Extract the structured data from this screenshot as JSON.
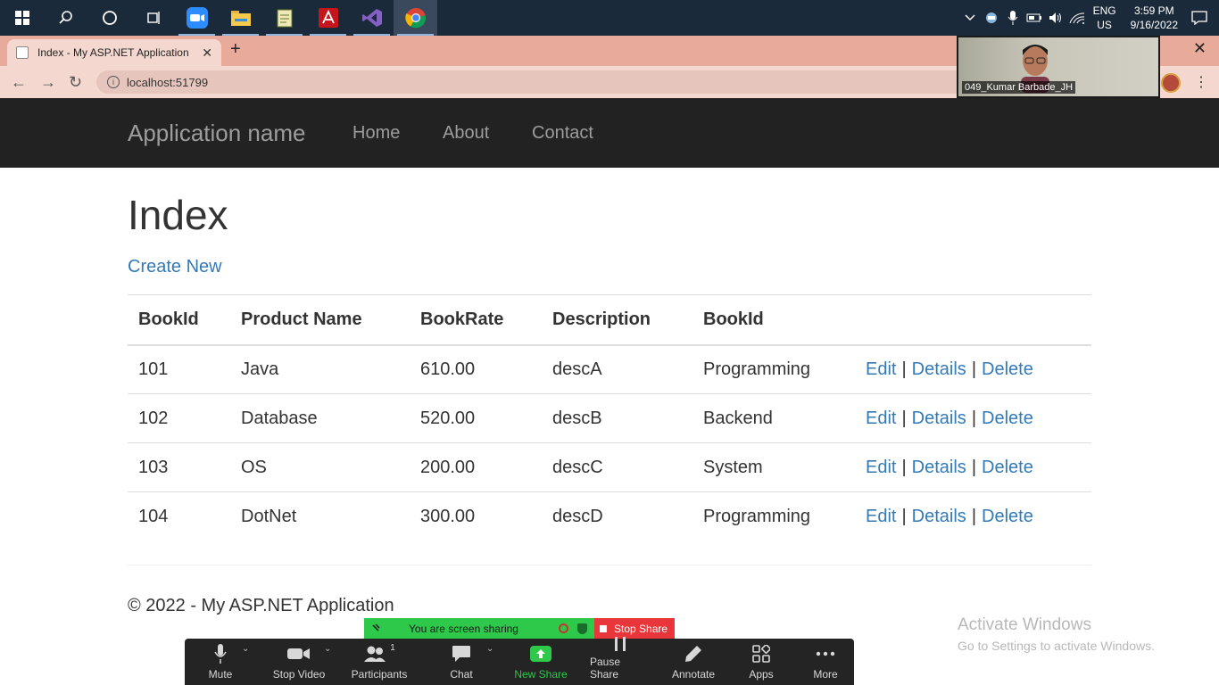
{
  "taskbar": {
    "apps": [
      "start-icon",
      "search-icon",
      "cortana-icon",
      "task-view-icon",
      "zoom-icon",
      "file-explorer-icon",
      "notepad-icon",
      "acrobat-icon",
      "visual-studio-icon",
      "chrome-icon"
    ],
    "lang_line1": "ENG",
    "lang_line2": "US",
    "time": "3:59 PM",
    "date": "9/16/2022"
  },
  "browser": {
    "tab_title": "Index - My ASP.NET Application",
    "url": "localhost:51799"
  },
  "video": {
    "participant_name": "049_Kumar Barbade_JH"
  },
  "navbar": {
    "brand": "Application name",
    "links": [
      "Home",
      "About",
      "Contact"
    ]
  },
  "page": {
    "title": "Index",
    "create_link": "Create New",
    "footer": "© 2022 - My ASP.NET Application"
  },
  "table": {
    "headers": [
      "BookId",
      "Product Name",
      "BookRate",
      "Description",
      "BookId"
    ],
    "rows": [
      [
        "101",
        "Java",
        "610.00",
        "descA",
        "Programming"
      ],
      [
        "102",
        "Database",
        "520.00",
        "descB",
        "Backend"
      ],
      [
        "103",
        "OS",
        "200.00",
        "descC",
        "System"
      ],
      [
        "104",
        "DotNet",
        "300.00",
        "descD",
        "Programming"
      ]
    ],
    "actions": {
      "edit": "Edit",
      "details": "Details",
      "delete": "Delete",
      "sep": "|"
    }
  },
  "activation": {
    "line1": "Activate Windows",
    "line2": "Go to Settings to activate Windows."
  },
  "zoom": {
    "sharing_message": "You are screen sharing",
    "stop_share": "Stop Share",
    "participant_count": "1",
    "toolbar": [
      "Mute",
      "Stop Video",
      "Participants",
      "Chat",
      "New Share",
      "Pause Share",
      "Annotate",
      "Apps",
      "More"
    ]
  },
  "colors": {
    "navbar_bg": "#222222",
    "link": "#337ab7",
    "tab_strip": "#e8aa9a",
    "share_green": "#2ec84b",
    "share_red": "#e8363a"
  }
}
